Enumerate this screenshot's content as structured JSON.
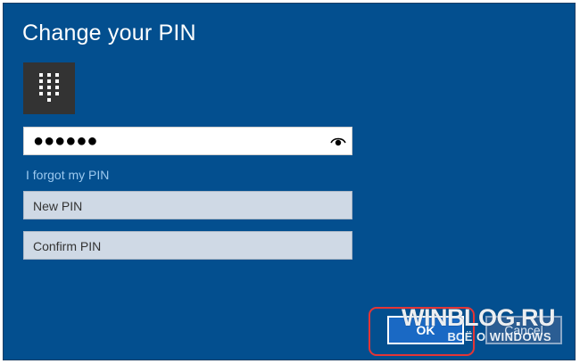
{
  "dialog": {
    "title": "Change your PIN",
    "colors": {
      "background": "#034f8f",
      "link": "#9cc9ef",
      "highlight": "#e53535"
    }
  },
  "pin_tile": {
    "icon": "keypad-icon"
  },
  "current_pin": {
    "value_masked": "●●●●●●",
    "reveal_icon": "eye-icon"
  },
  "forgot_link": "I forgot my PIN",
  "new_pin": {
    "placeholder": "New PIN"
  },
  "confirm_pin": {
    "placeholder": "Confirm PIN"
  },
  "buttons": {
    "ok_label": "OK",
    "cancel_label": "Cancel"
  },
  "watermark": {
    "main": "WINBLOG.RU",
    "sub": "ВСЁ О WINDOWS"
  }
}
